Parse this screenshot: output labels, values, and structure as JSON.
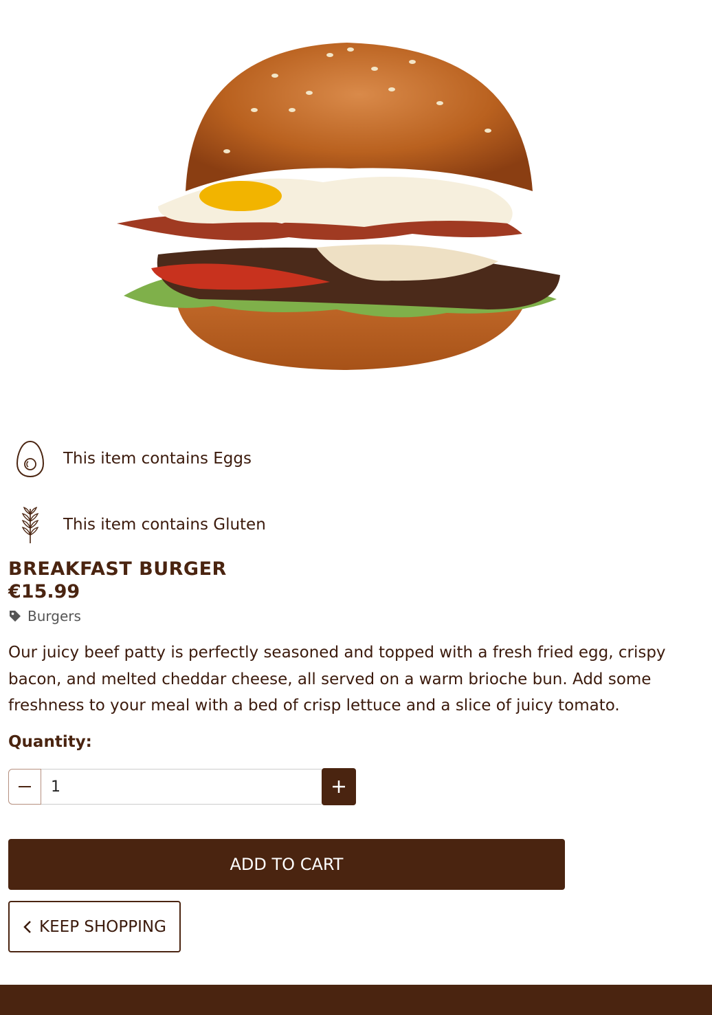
{
  "product": {
    "image_alt": "breakfast-burger-photo",
    "name": "BREAKFAST BURGER",
    "price": "€15.99",
    "category": "Burgers",
    "description": "Our juicy beef patty is perfectly seasoned and topped with a fresh fried egg, crispy bacon, and melted cheddar cheese, all served on a warm brioche bun. Add some freshness to your meal with a bed of crisp lettuce and a slice of juicy tomato."
  },
  "allergens": [
    {
      "label": "This item contains Eggs",
      "icon": "egg-icon"
    },
    {
      "label": "This item contains Gluten",
      "icon": "wheat-icon"
    }
  ],
  "quantity": {
    "label": "Quantity:",
    "value": "1"
  },
  "actions": {
    "add_to_cart": "ADD TO CART",
    "keep_shopping": "KEEP SHOPPING"
  },
  "colors": {
    "brand": "#4a2410",
    "text": "#3b1a0c",
    "background": "#ffffff"
  }
}
